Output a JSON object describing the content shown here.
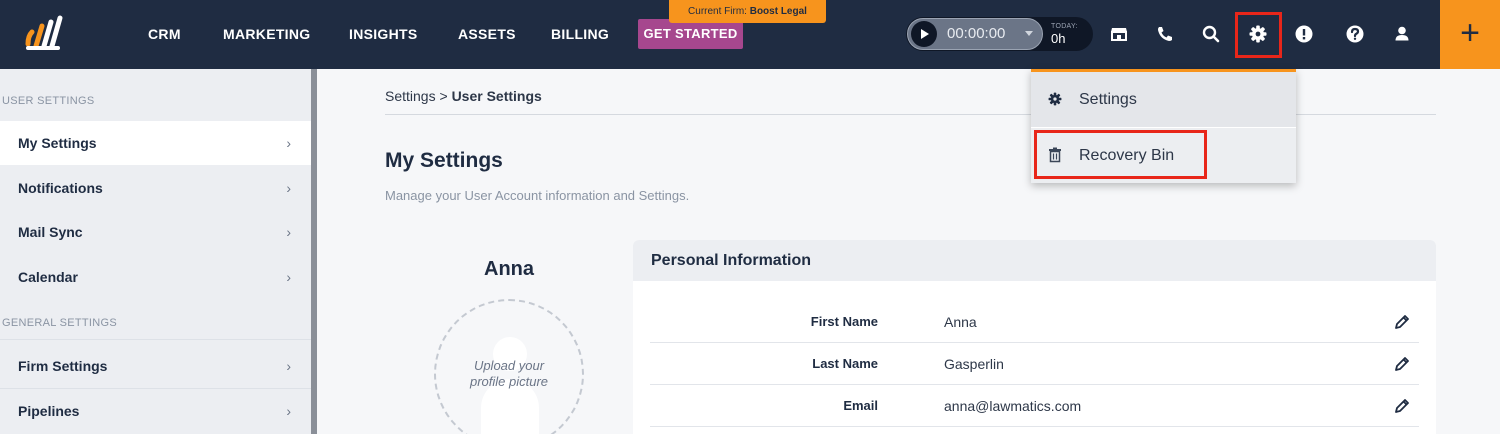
{
  "header": {
    "nav": [
      "CRM",
      "MARKETING",
      "INSIGHTS",
      "ASSETS",
      "BILLING"
    ],
    "get_started": "GET STARTED",
    "firm_label": "Current Firm:",
    "firm_name": "Boost Legal",
    "timer": {
      "time": "00:00:00",
      "today_label": "TODAY",
      "today_value": "0h"
    },
    "plus": "+",
    "icons": [
      "store-icon",
      "phone-icon",
      "search-icon",
      "gear-icon",
      "alert-icon",
      "help-icon",
      "user-icon"
    ]
  },
  "sidebar": {
    "user_section": "USER SETTINGS",
    "general_section": "GENERAL SETTINGS",
    "user_items": [
      "My Settings",
      "Notifications",
      "Mail Sync",
      "Calendar"
    ],
    "general_items": [
      "Firm Settings",
      "Pipelines"
    ],
    "chevron": "›"
  },
  "breadcrumb": {
    "root": "Settings",
    "separator": ">",
    "current": "User Settings"
  },
  "page": {
    "title": "My Settings",
    "subtitle": "Manage your User Account information and Settings."
  },
  "profile": {
    "name": "Anna",
    "upload_line1": "Upload your",
    "upload_line2": "profile picture"
  },
  "personal_info": {
    "title": "Personal Information",
    "fields": [
      {
        "label": "First Name",
        "value": "Anna"
      },
      {
        "label": "Last Name",
        "value": "Gasperlin"
      },
      {
        "label": "Email",
        "value": "anna@lawmatics.com"
      }
    ]
  },
  "dropdown": {
    "items": [
      "Settings",
      "Recovery Bin"
    ]
  },
  "colors": {
    "navy": "#1f2c42",
    "orange": "#f7941d",
    "purple": "#a6478e",
    "highlight": "#e8261a"
  }
}
